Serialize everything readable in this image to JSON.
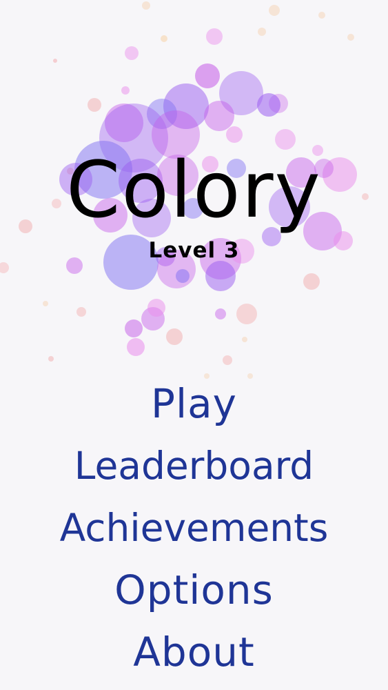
{
  "app": {
    "title": "Colory",
    "level_label": "Level 3"
  },
  "menu": {
    "items": [
      {
        "label": "Play"
      },
      {
        "label": "Leaderboard"
      },
      {
        "label": "Achievements"
      },
      {
        "label": "Options"
      },
      {
        "label": "About"
      }
    ]
  },
  "colors": {
    "background": "#f7f6f9",
    "title_text": "#000000",
    "menu_text": "#1f3596",
    "bubble_palette": [
      "#9a5cf0",
      "#c45ae8",
      "#7f6ff2",
      "#e98cec",
      "#f3b3b5",
      "#f8d3a8"
    ]
  }
}
